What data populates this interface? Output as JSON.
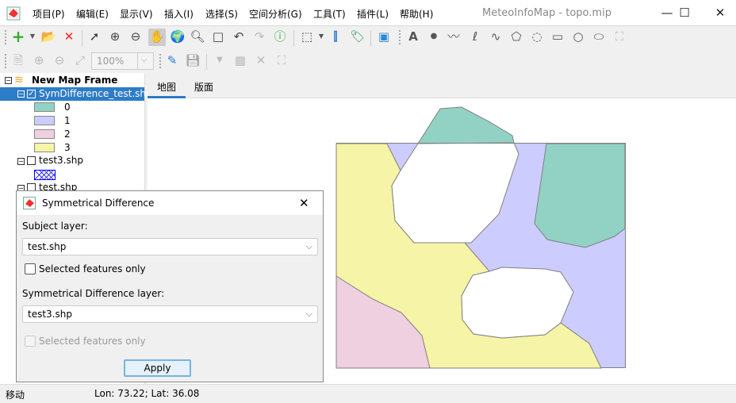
{
  "window": {
    "title": "MeteoInfoMap - topo.mip",
    "minimize": "—",
    "maximize": "☐",
    "close": "✕"
  },
  "menu": [
    "项目(P)",
    "编辑(E)",
    "显示(V)",
    "插入(I)",
    "选择(S)",
    "空间分析(G)",
    "工具(T)",
    "插件(L)",
    "帮助(H)"
  ],
  "toolbar": {
    "zoom_value": "100%"
  },
  "tree": {
    "frame": "New Map Frame",
    "layers": [
      {
        "name": "SymDifference_test.shp",
        "checked": true,
        "legend": [
          {
            "label": "0",
            "color": "#92d2c4"
          },
          {
            "label": "1",
            "color": "#ccccff"
          },
          {
            "label": "2",
            "color": "#efd0e0"
          },
          {
            "label": "3",
            "color": "#f5f4a7"
          }
        ]
      },
      {
        "name": "test3.shp",
        "checked": false
      },
      {
        "name": "test.shp",
        "checked": false
      }
    ]
  },
  "tabs": [
    "地图",
    "版面"
  ],
  "map": {
    "colors": {
      "teal": "#92d2c4",
      "lavender": "#ccccff",
      "pink": "#efd0e0",
      "yellow": "#f5f4a7",
      "outline": "#808080"
    }
  },
  "dialog": {
    "title": "Symmetrical Difference",
    "subject_label": "Subject layer:",
    "subject_value": "test.shp",
    "selected_only_1": "Selected features only",
    "symdiff_label": "Symmetrical Difference layer:",
    "symdiff_value": "test3.shp",
    "selected_only_2": "Selected features only",
    "apply": "Apply",
    "close": "✕"
  },
  "status": {
    "mode": "移动",
    "coords": "Lon: 73.22; Lat: 36.08"
  }
}
